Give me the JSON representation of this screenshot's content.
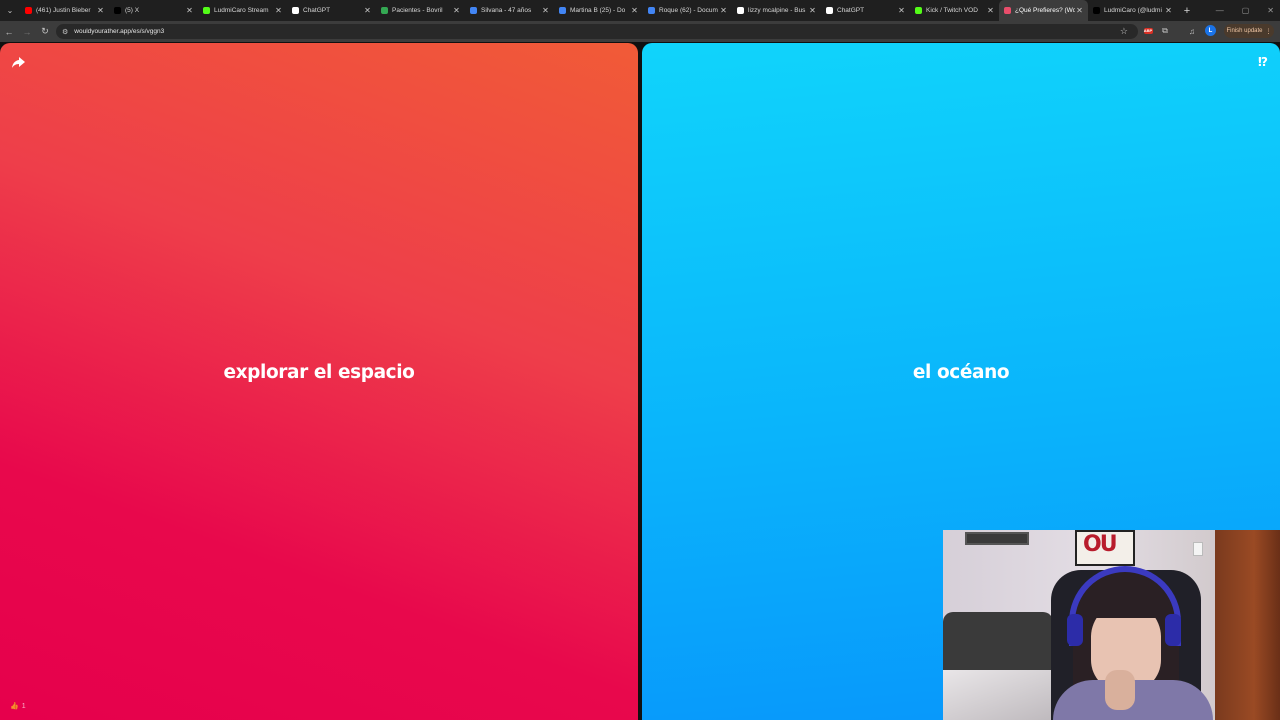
{
  "browser": {
    "tabs": [
      {
        "label": "(461) Justin Bieber",
        "favicon": "youtube-icon",
        "color": "#ff0000",
        "active": false
      },
      {
        "label": "(5) X",
        "favicon": "x-icon",
        "color": "#000000",
        "active": false
      },
      {
        "label": "LudmiCaro Stream",
        "favicon": "kick-icon",
        "color": "#53fc18",
        "active": false
      },
      {
        "label": "ChatGPT",
        "favicon": "chatgpt-icon",
        "color": "#ffffff",
        "active": false
      },
      {
        "label": "Pacientes - Bovril",
        "favicon": "drive-icon",
        "color": "#34a853",
        "active": false
      },
      {
        "label": "Silvana - 47 años",
        "favicon": "docs-icon",
        "color": "#4285f4",
        "active": false
      },
      {
        "label": "Martina B (25) - Do",
        "favicon": "docs-icon",
        "color": "#4285f4",
        "active": false
      },
      {
        "label": "Roque (62) - Docum",
        "favicon": "docs-icon",
        "color": "#4285f4",
        "active": false
      },
      {
        "label": "lizzy mcalpine - Bus",
        "favicon": "google-icon",
        "color": "#ffffff",
        "active": false
      },
      {
        "label": "ChatGPT",
        "favicon": "chatgpt-icon",
        "color": "#ffffff",
        "active": false
      },
      {
        "label": "Kick / Twitch VOD",
        "favicon": "kick-icon",
        "color": "#53fc18",
        "active": false
      },
      {
        "label": "¿Qué Prefieres? (Wo",
        "favicon": "wyr-icon",
        "color": "#e84d6b",
        "active": true
      },
      {
        "label": "LudmiCaro (@ludmi",
        "favicon": "tiktok-icon",
        "color": "#000000",
        "active": false
      }
    ],
    "url": "wouldyourather.app/es/s/vggn3",
    "update_label": "Finish update"
  },
  "profile_initial": "L",
  "game": {
    "option_a": "explorar el espacio",
    "option_b": "el océano",
    "likes": "1",
    "help_label": "⁉",
    "colors": {
      "option_a": "#e8084c",
      "option_b": "#0ab4fb"
    }
  }
}
